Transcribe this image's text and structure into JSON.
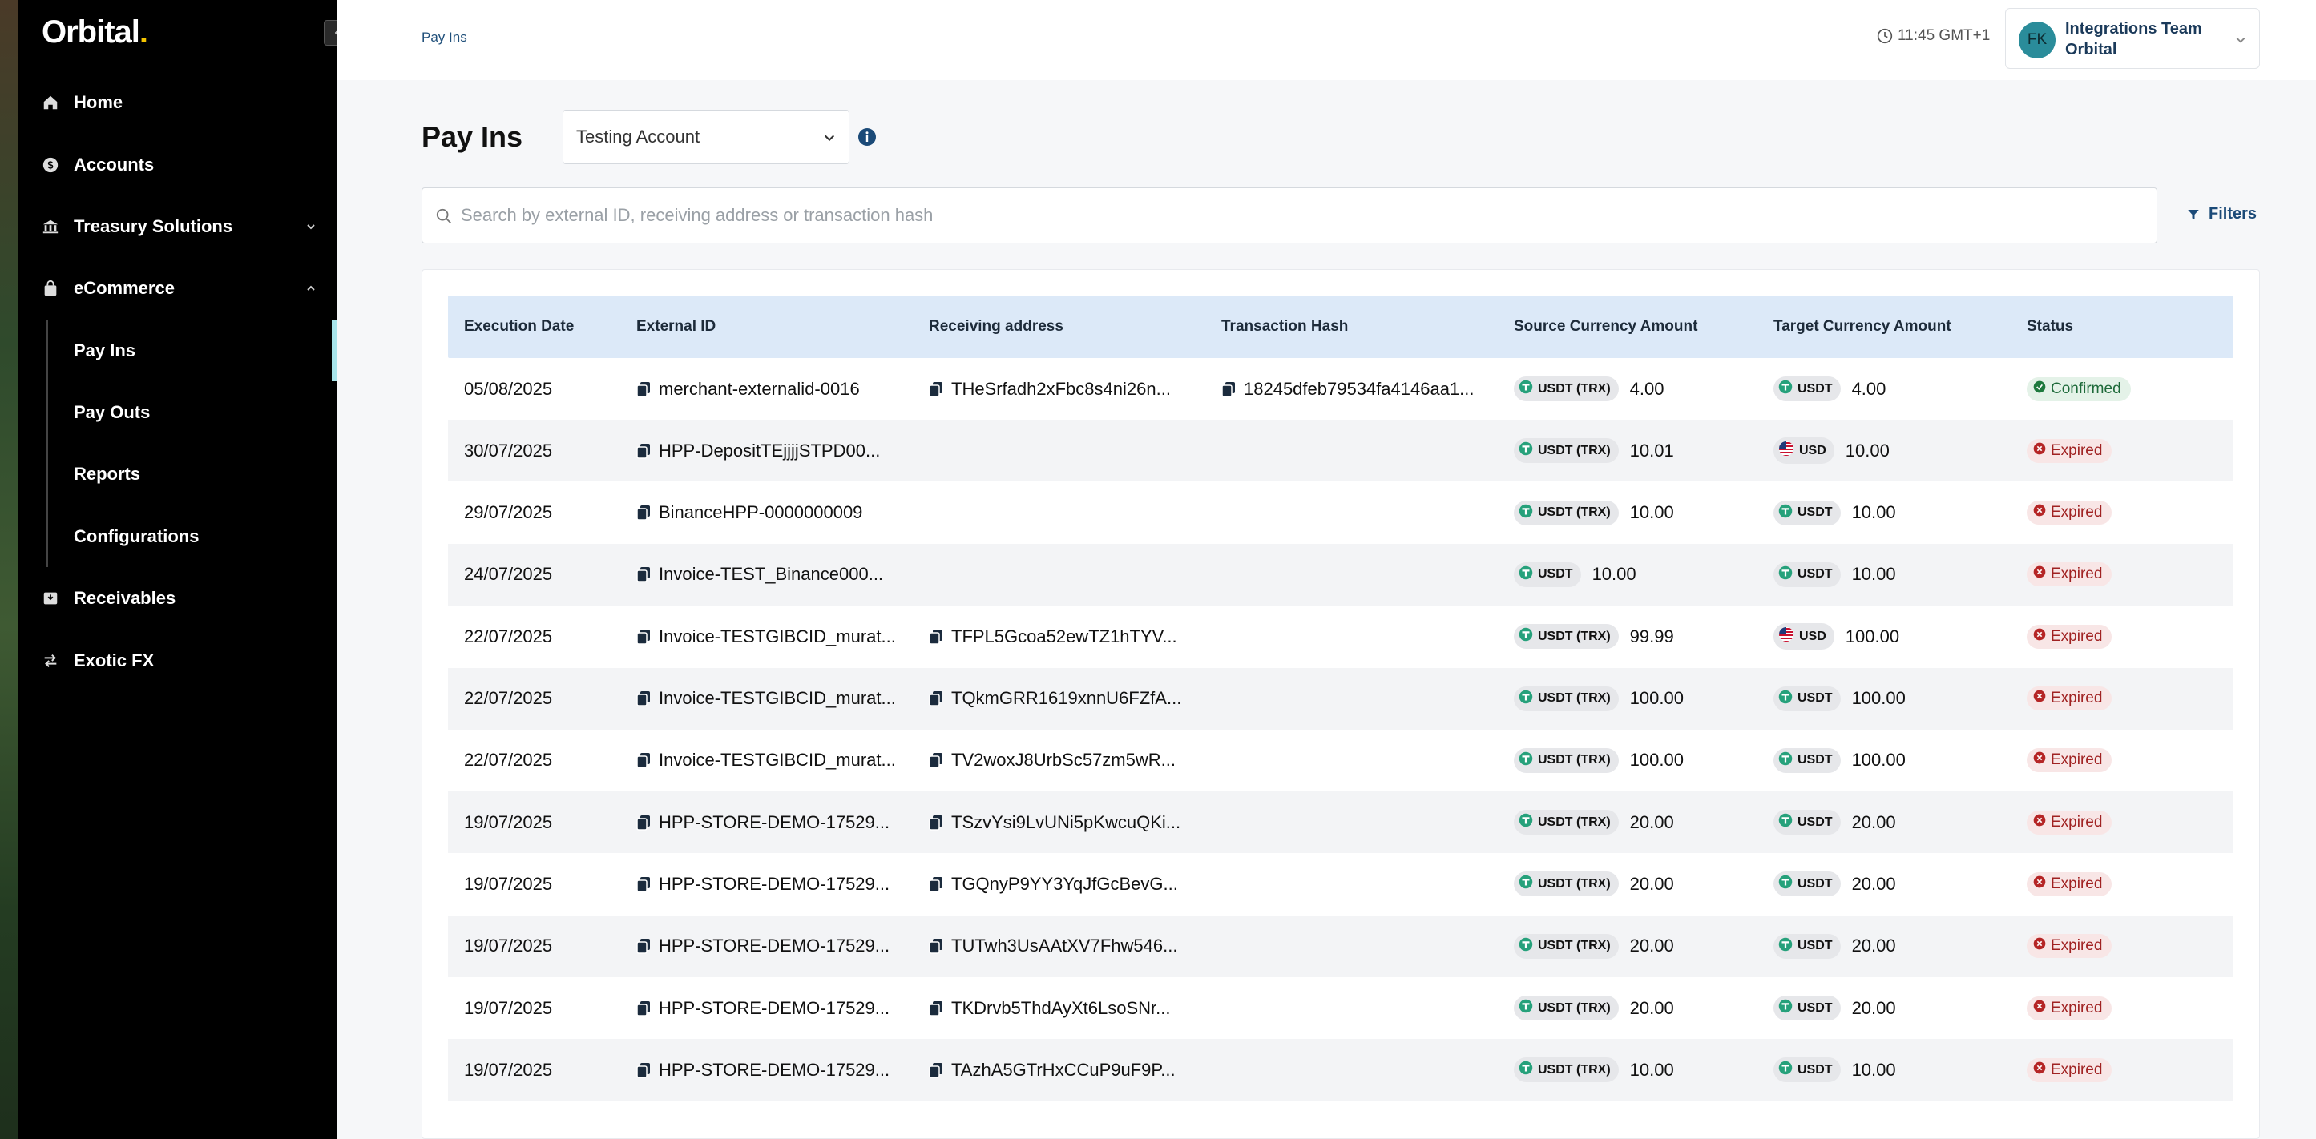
{
  "sidebar": {
    "logo": "Orbital",
    "logo_dot": ".",
    "collapse_icon": "‹",
    "items": [
      {
        "label": "Home",
        "icon": "home-icon"
      },
      {
        "label": "Accounts",
        "icon": "dollar-icon"
      },
      {
        "label": "Treasury Solutions",
        "icon": "bank-icon"
      },
      {
        "label": "eCommerce",
        "icon": "bag-icon"
      },
      {
        "label": "Receivables",
        "icon": "inbox-icon"
      },
      {
        "label": "Exotic FX",
        "icon": "exchange-icon"
      }
    ],
    "sub_items": [
      {
        "label": "Pay Ins",
        "active": true
      },
      {
        "label": "Pay Outs"
      },
      {
        "label": "Reports"
      },
      {
        "label": "Configurations"
      }
    ]
  },
  "header": {
    "breadcrumb": "Pay Ins",
    "time": "11:45 GMT+1",
    "user": {
      "initials": "FK",
      "name": "Integrations Team Orbital"
    }
  },
  "page": {
    "title": "Pay Ins",
    "account_select": "Testing Account",
    "search_placeholder": "Search by external ID, receiving address or transaction hash",
    "filters_label": "Filters"
  },
  "table": {
    "columns": [
      "Execution Date",
      "External ID",
      "Receiving address",
      "Transaction Hash",
      "Source Currency Amount",
      "Target Currency Amount",
      "Status"
    ],
    "rows": [
      {
        "date": "05/08/2025",
        "external_id": "merchant-externalid-0016",
        "address": "THeSrfadh2xFbc8s4ni26n...",
        "hash": "18245dfeb79534fa4146aa1...",
        "src_cur": "USDT (TRX)",
        "src_amt": "4.00",
        "tgt_cur": "USDT",
        "tgt_amt": "4.00",
        "status": "Confirmed"
      },
      {
        "date": "30/07/2025",
        "external_id": "HPP-DepositTEjjjjSTPD00...",
        "address": "",
        "hash": "",
        "src_cur": "USDT (TRX)",
        "src_amt": "10.01",
        "tgt_cur": "USD",
        "tgt_amt": "10.00",
        "status": "Expired"
      },
      {
        "date": "29/07/2025",
        "external_id": "BinanceHPP-0000000009",
        "address": "",
        "hash": "",
        "src_cur": "USDT (TRX)",
        "src_amt": "10.00",
        "tgt_cur": "USDT",
        "tgt_amt": "10.00",
        "status": "Expired"
      },
      {
        "date": "24/07/2025",
        "external_id": "Invoice-TEST_Binance000...",
        "address": "",
        "hash": "",
        "src_cur": "USDT",
        "src_amt": "10.00",
        "tgt_cur": "USDT",
        "tgt_amt": "10.00",
        "status": "Expired"
      },
      {
        "date": "22/07/2025",
        "external_id": "Invoice-TESTGIBCID_murat...",
        "address": "TFPL5Gcoa52ewTZ1hTYV...",
        "hash": "",
        "src_cur": "USDT (TRX)",
        "src_amt": "99.99",
        "tgt_cur": "USD",
        "tgt_amt": "100.00",
        "status": "Expired"
      },
      {
        "date": "22/07/2025",
        "external_id": "Invoice-TESTGIBCID_murat...",
        "address": "TQkmGRR1619xnnU6FZfA...",
        "hash": "",
        "src_cur": "USDT (TRX)",
        "src_amt": "100.00",
        "tgt_cur": "USDT",
        "tgt_amt": "100.00",
        "status": "Expired"
      },
      {
        "date": "22/07/2025",
        "external_id": "Invoice-TESTGIBCID_murat...",
        "address": "TV2woxJ8UrbSc57zm5wR...",
        "hash": "",
        "src_cur": "USDT (TRX)",
        "src_amt": "100.00",
        "tgt_cur": "USDT",
        "tgt_amt": "100.00",
        "status": "Expired"
      },
      {
        "date": "19/07/2025",
        "external_id": "HPP-STORE-DEMO-17529...",
        "address": "TSzvYsi9LvUNi5pKwcuQKi...",
        "hash": "",
        "src_cur": "USDT (TRX)",
        "src_amt": "20.00",
        "tgt_cur": "USDT",
        "tgt_amt": "20.00",
        "status": "Expired"
      },
      {
        "date": "19/07/2025",
        "external_id": "HPP-STORE-DEMO-17529...",
        "address": "TGQnyP9YY3YqJfGcBevG...",
        "hash": "",
        "src_cur": "USDT (TRX)",
        "src_amt": "20.00",
        "tgt_cur": "USDT",
        "tgt_amt": "20.00",
        "status": "Expired"
      },
      {
        "date": "19/07/2025",
        "external_id": "HPP-STORE-DEMO-17529...",
        "address": "TUTwh3UsAAtXV7Fhw546...",
        "hash": "",
        "src_cur": "USDT (TRX)",
        "src_amt": "20.00",
        "tgt_cur": "USDT",
        "tgt_amt": "20.00",
        "status": "Expired"
      },
      {
        "date": "19/07/2025",
        "external_id": "HPP-STORE-DEMO-17529...",
        "address": "TKDrvb5ThdAyXt6LsoSNr...",
        "hash": "",
        "src_cur": "USDT (TRX)",
        "src_amt": "20.00",
        "tgt_cur": "USDT",
        "tgt_amt": "20.00",
        "status": "Expired"
      },
      {
        "date": "19/07/2025",
        "external_id": "HPP-STORE-DEMO-17529...",
        "address": "TAzhA5GTrHxCCuP9uF9P...",
        "hash": "",
        "src_cur": "USDT (TRX)",
        "src_amt": "10.00",
        "tgt_cur": "USDT",
        "tgt_amt": "10.00",
        "status": "Expired"
      }
    ]
  },
  "colors": {
    "accent": "#1b4a78",
    "header_bg": "#dce9f8",
    "confirmed": "#1e6a3a",
    "expired": "#a02222",
    "tether": "#26a17b"
  }
}
